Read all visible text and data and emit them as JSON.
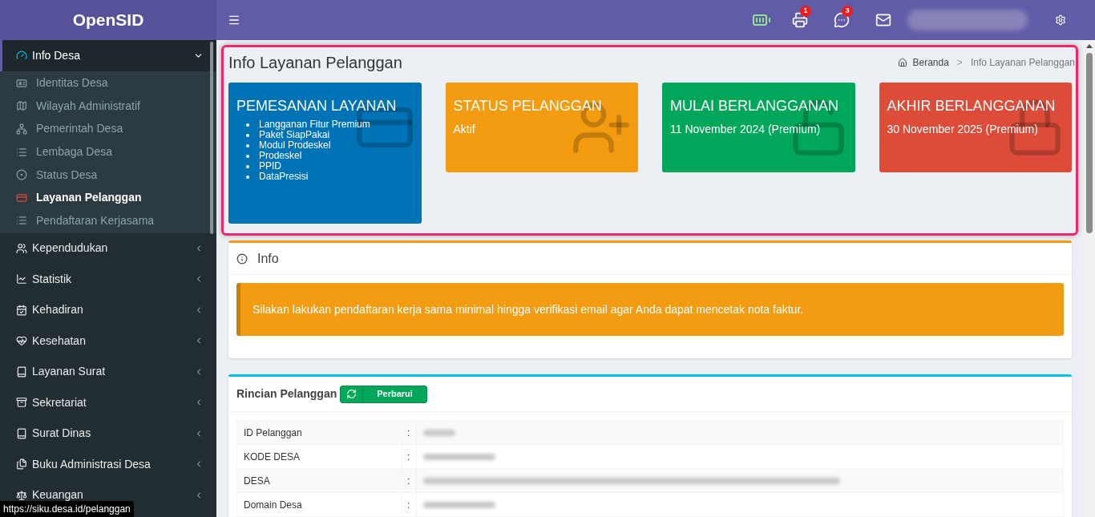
{
  "sidebar": {
    "brand": "OpenSID",
    "menu": [
      {
        "label": "Info Desa",
        "expanded": true,
        "children": [
          {
            "label": "Identitas Desa",
            "selected": false
          },
          {
            "label": "Wilayah Administratif",
            "selected": false
          },
          {
            "label": "Pemerintah Desa",
            "selected": false
          },
          {
            "label": "Lembaga Desa",
            "selected": false
          },
          {
            "label": "Status Desa",
            "selected": false
          },
          {
            "label": "Layanan Pelanggan",
            "selected": true
          },
          {
            "label": "Pendaftaran Kerjasama",
            "selected": false
          }
        ]
      },
      {
        "label": "Kependudukan",
        "expanded": false
      },
      {
        "label": "Statistik",
        "expanded": false
      },
      {
        "label": "Kehadiran",
        "expanded": false
      },
      {
        "label": "Kesehatan",
        "expanded": false
      },
      {
        "label": "Layanan Surat",
        "expanded": false
      },
      {
        "label": "Sekretariat",
        "expanded": false
      },
      {
        "label": "Surat Dinas",
        "expanded": false
      },
      {
        "label": "Buku Administrasi Desa",
        "expanded": false
      },
      {
        "label": "Keuangan",
        "expanded": false
      }
    ]
  },
  "topbar": {
    "notifications": [
      {
        "badge": "1"
      },
      {
        "badge": "3"
      }
    ]
  },
  "page": {
    "title": "Info Layanan Pelanggan",
    "breadcrumb": [
      "Beranda",
      "Info Layanan Pelanggan"
    ],
    "breadcrumb_separator": ">"
  },
  "cards": [
    {
      "title": "PEMESANAN LAYANAN",
      "color": "#0073b7",
      "items": [
        "Langganan Fitur Premium",
        "Paket SiapPakai",
        "Modul Prodeskel",
        "Prodeskel",
        "PPID",
        "DataPresisi"
      ]
    },
    {
      "title": "STATUS PELANGGAN",
      "color": "#f39c12",
      "value": "Aktif"
    },
    {
      "title": "MULAI BERLANGGANAN",
      "color": "#00a65a",
      "value": "11 November 2024 (Premium)"
    },
    {
      "title": "AKHIR BERLANGGANAN",
      "color": "#dd4b39",
      "value": "30 November 2025 (Premium)"
    }
  ],
  "info_box": {
    "title": "Info",
    "alert": "Silakan lakukan pendaftaran kerja sama minimal hingga verifikasi email agar Anda dapat mencetak nota faktur."
  },
  "details": {
    "title": "Rincian Pelanggan",
    "button": "Perbarui",
    "rows": [
      {
        "label": "ID Pelanggan",
        "separator": ":"
      },
      {
        "label": "KODE DESA",
        "separator": ":"
      },
      {
        "label": "DESA",
        "separator": ":"
      },
      {
        "label": "Domain Desa",
        "separator": ":"
      }
    ]
  },
  "status_url": "https://siku.desa.id/pelanggan"
}
